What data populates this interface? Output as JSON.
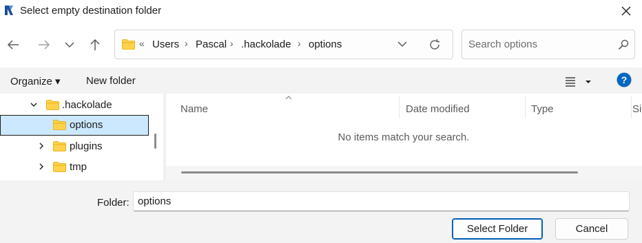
{
  "window": {
    "title": "Select empty destination folder"
  },
  "address": {
    "overflow": "«",
    "crumbs": [
      "Users",
      "Pascal",
      ".hackolade",
      "options"
    ]
  },
  "search": {
    "placeholder": "Search options"
  },
  "toolbar": {
    "organize_label": "Organize ▾",
    "new_folder_label": "New folder"
  },
  "tree": {
    "items": [
      {
        "label": ".hackolade",
        "expanded": true
      },
      {
        "label": "options",
        "selected": true
      },
      {
        "label": "plugins"
      },
      {
        "label": "tmp"
      }
    ]
  },
  "list": {
    "columns": [
      "Name",
      "Date modified",
      "Type",
      "Si"
    ],
    "empty_message": "No items match your search."
  },
  "footer": {
    "folder_label": "Folder:",
    "folder_value": "options",
    "select_button": "Select Folder",
    "cancel_button": "Cancel"
  },
  "colors": {
    "accent": "#005fb8",
    "selection": "#cce8ff",
    "folder": "#ffd24d"
  },
  "icons": [
    "app-logo-icon",
    "close-icon",
    "back-arrow-icon",
    "forward-arrow-icon",
    "recent-chevron-icon",
    "up-arrow-icon",
    "folder-icon",
    "chevron-down-icon",
    "refresh-icon",
    "search-icon",
    "list-view-icon",
    "help-icon",
    "chevron-right-icon"
  ]
}
